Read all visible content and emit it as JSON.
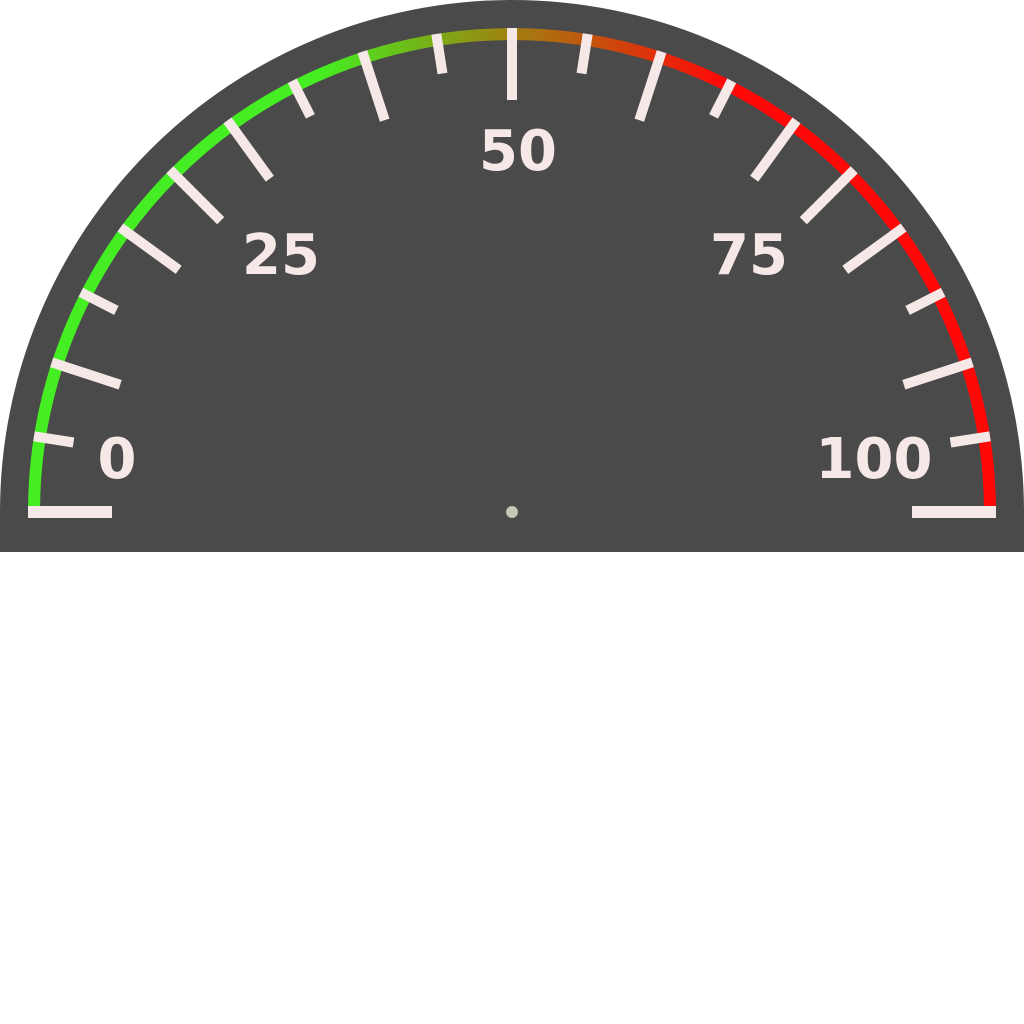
{
  "gauge": {
    "min": 0,
    "max": 100,
    "major_step": 25,
    "minor_step": 5,
    "labels": [
      {
        "value": 0,
        "text": "0"
      },
      {
        "value": 25,
        "text": "25"
      },
      {
        "value": 50,
        "text": "50"
      },
      {
        "value": 75,
        "text": "75"
      },
      {
        "value": 100,
        "text": "100"
      }
    ],
    "colors": {
      "face": "#4a4a4a",
      "tick": "#f7e8e8",
      "label": "#f7e8e8",
      "pivot": "#c8c8b4",
      "arc_low": "#44ee22",
      "arc_mid": "#a08010",
      "arc_high": "#ff0808"
    },
    "icons": {
      "pivot": "needle-pivot-dot"
    }
  }
}
